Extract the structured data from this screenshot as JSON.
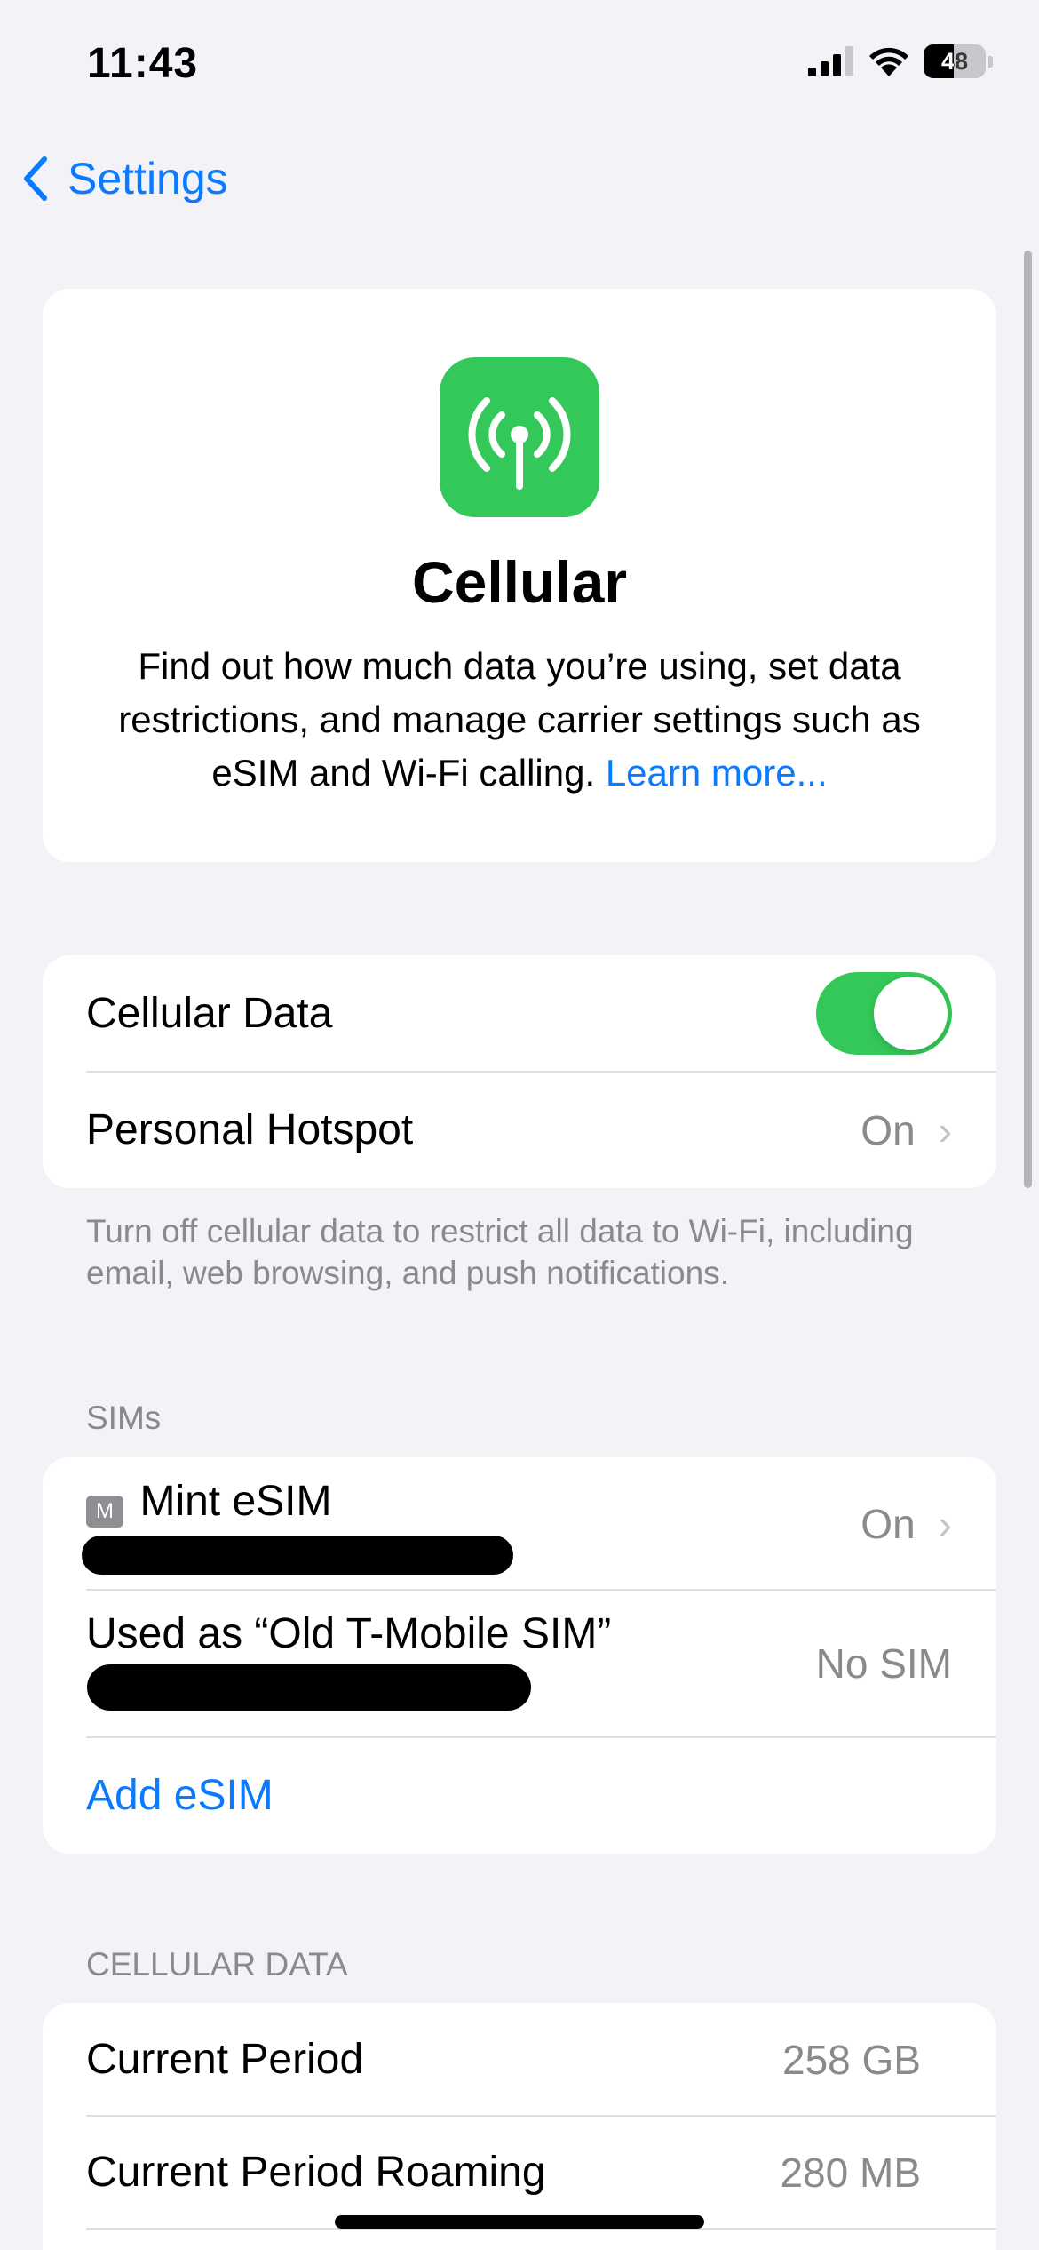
{
  "status_bar": {
    "time": "11:43",
    "battery_level": "48",
    "battery_fraction": 0.48
  },
  "nav": {
    "back_label": "Settings"
  },
  "hero": {
    "icon": "antenna-radiowaves-icon",
    "title": "Cellular",
    "description": "Find out how much data you’re using, set data restrictions, and manage carrier settings such as eSIM and Wi-Fi calling.",
    "learn_more": "Learn more..."
  },
  "cellular_group": {
    "cellular_data_label": "Cellular Data",
    "cellular_data_on": true,
    "hotspot_label": "Personal Hotspot",
    "hotspot_value": "On",
    "footer": "Turn off cellular data to restrict all data to Wi-Fi, including email, web browsing, and push notifications."
  },
  "sims": {
    "header": "SIMs",
    "items": [
      {
        "badge": "M",
        "label": "Mint eSIM",
        "value": "On"
      },
      {
        "label": "Used as “Old T-Mobile SIM”",
        "value": "No SIM"
      }
    ],
    "add_label": "Add eSIM"
  },
  "cellular_data_section": {
    "header": "CELLULAR DATA",
    "rows": [
      {
        "label": "Current Period",
        "value": "258 GB"
      },
      {
        "label": "Current Period Roaming",
        "value": "280 MB"
      }
    ]
  },
  "colors": {
    "accent": "#0a7aff",
    "green": "#34c759",
    "background": "#f2f2f7"
  }
}
